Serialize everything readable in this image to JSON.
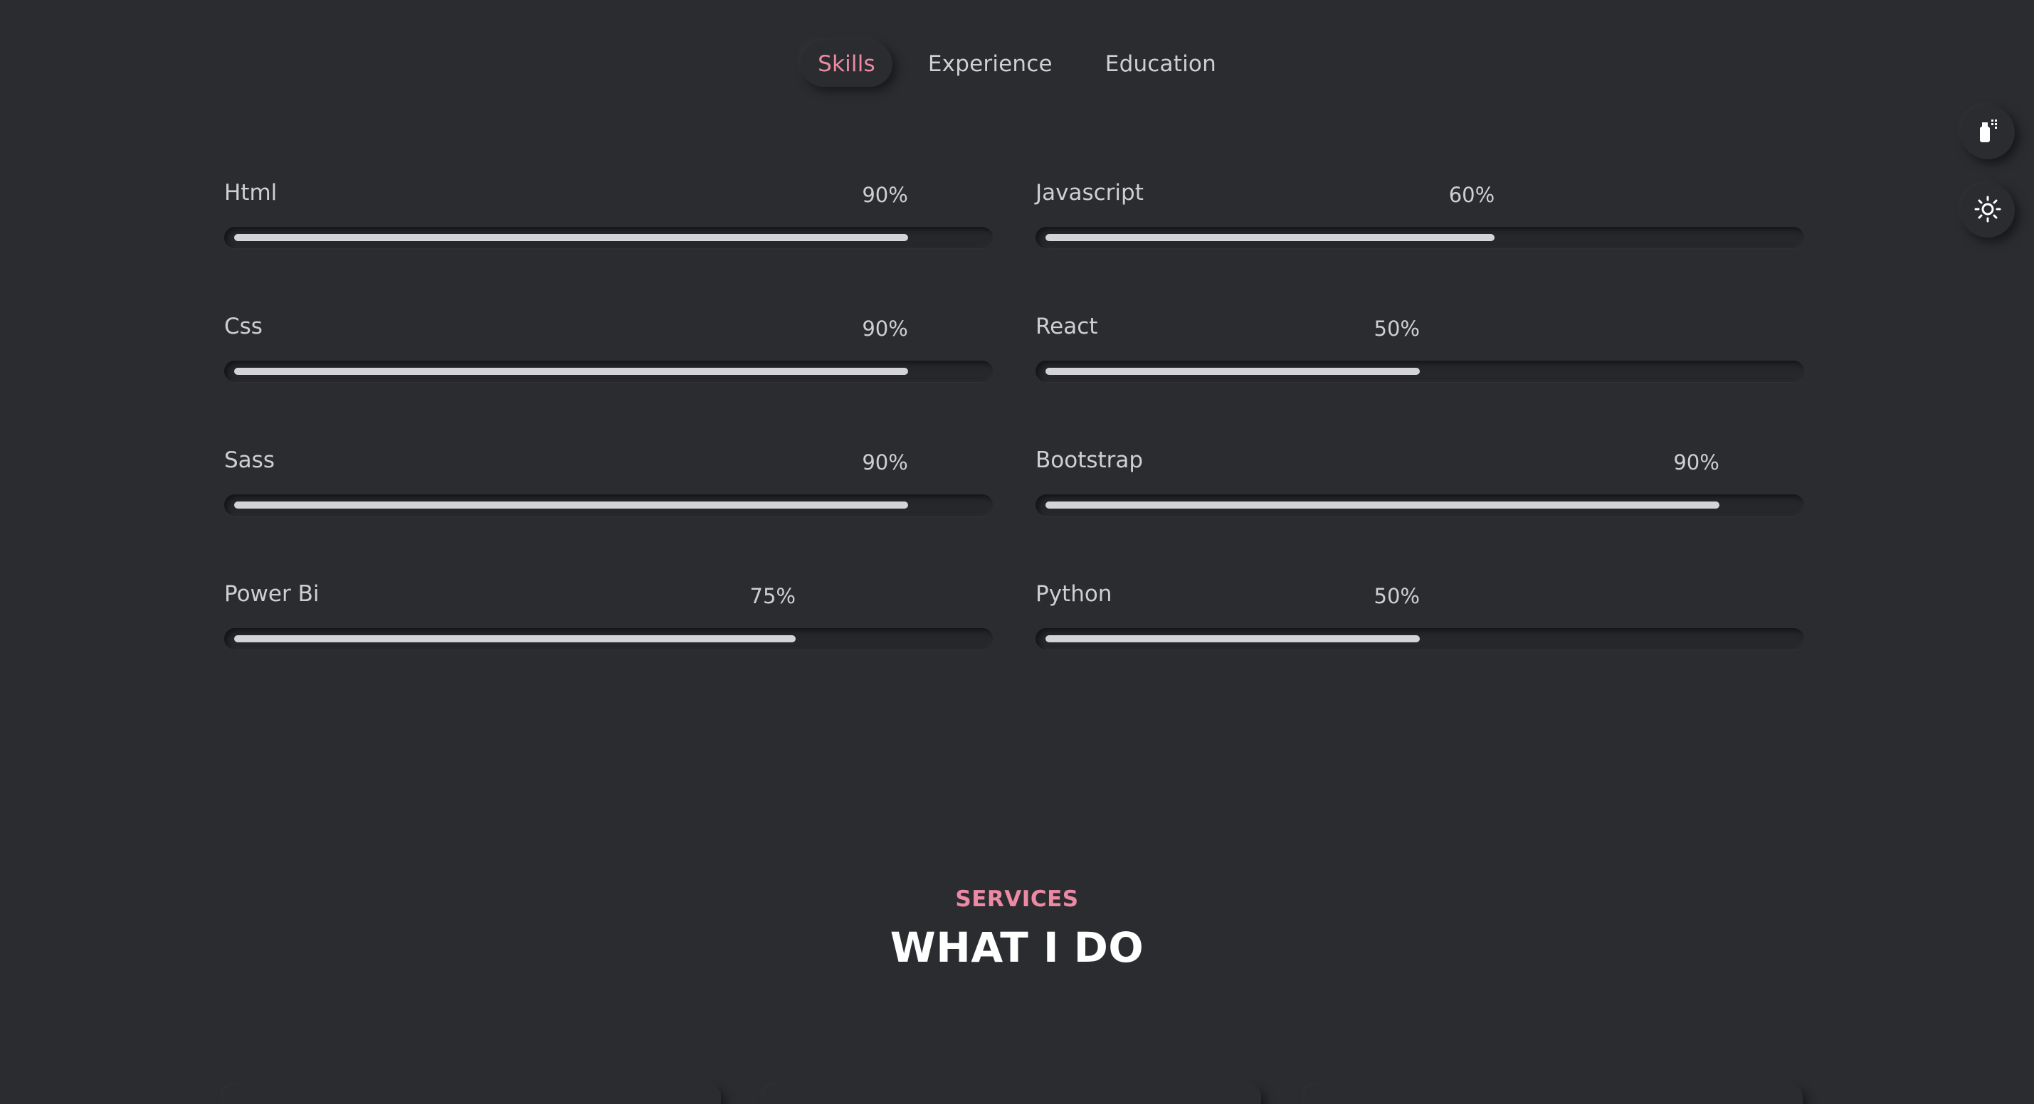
{
  "tabs": [
    {
      "label": "Skills",
      "active": true
    },
    {
      "label": "Experience",
      "active": false
    },
    {
      "label": "Education",
      "active": false
    }
  ],
  "skills": [
    {
      "name": "Html",
      "percent_label": "90%",
      "percent": 90
    },
    {
      "name": "Javascript",
      "percent_label": "60%",
      "percent": 60
    },
    {
      "name": "Css",
      "percent_label": "90%",
      "percent": 90
    },
    {
      "name": "React",
      "percent_label": "50%",
      "percent": 50
    },
    {
      "name": "Sass",
      "percent_label": "90%",
      "percent": 90
    },
    {
      "name": "Bootstrap",
      "percent_label": "90%",
      "percent": 90
    },
    {
      "name": "Power Bi",
      "percent_label": "75%",
      "percent": 75
    },
    {
      "name": "Python",
      "percent_label": "50%",
      "percent": 50
    }
  ],
  "side_buttons": [
    {
      "icon": "spray-paint-icon"
    },
    {
      "icon": "sun-icon"
    }
  ],
  "services": {
    "subtitle": "SERVICES",
    "title": "WHAT I DO"
  },
  "colors": {
    "background": "#2b2c30",
    "accent": "#ec8aa4",
    "bar_fill": "#d4d4d7",
    "text": "#cfcfd3"
  }
}
